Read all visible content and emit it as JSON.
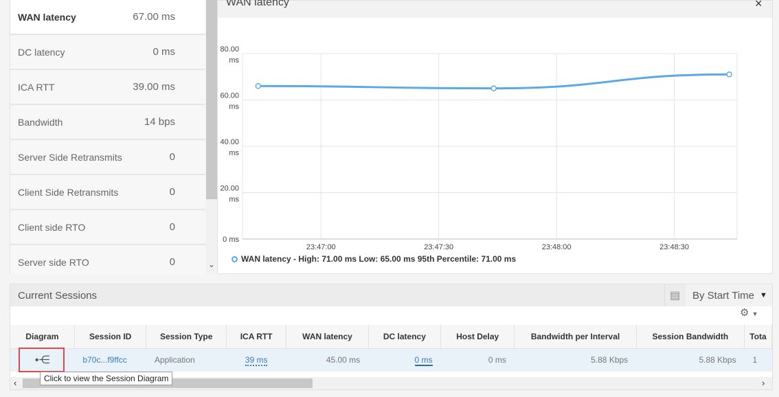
{
  "metrics": [
    {
      "label": "WAN latency",
      "value": "67.00 ms",
      "selected": true
    },
    {
      "label": "DC latency",
      "value": "0 ms"
    },
    {
      "label": "ICA RTT",
      "value": "39.00 ms"
    },
    {
      "label": "Bandwidth",
      "value": "14 bps"
    },
    {
      "label": "Server Side Retransmits",
      "value": "0"
    },
    {
      "label": "Client Side Retransmits",
      "value": "0"
    },
    {
      "label": "Client side RTO",
      "value": "0"
    },
    {
      "label": "Server side RTO",
      "value": "0"
    }
  ],
  "chart_panel": {
    "title": "WAN latency",
    "close": "×"
  },
  "chart_data": {
    "type": "line",
    "title": "WAN latency",
    "x": [
      "23:46:44",
      "23:47:44",
      "23:48:44"
    ],
    "series": [
      {
        "name": "WAN latency",
        "values": [
          66,
          65,
          71
        ],
        "color": "#5aa9e6"
      }
    ],
    "x_ticks": [
      "23:47:00",
      "23:47:30",
      "23:48:00",
      "23:48:30"
    ],
    "y_ticks": [
      "0 ms",
      "20.00 ms",
      "40.00 ms",
      "60.00 ms",
      "80.00 ms"
    ],
    "ylim": [
      0,
      80
    ],
    "xlim": [
      "23:46:40",
      "23:48:46"
    ],
    "grid": true,
    "legend": "WAN latency - High: 71.00 ms Low: 65.00 ms 95th Percentile: 71.00 ms",
    "legend_placement": "bottom-left"
  },
  "sessions": {
    "title": "Current Sessions",
    "sort": "By Start Time",
    "columns": [
      "Diagram",
      "Session ID",
      "Session Type",
      "ICA RTT",
      "WAN latency",
      "DC latency",
      "Host Delay",
      "Bandwidth per Interval",
      "Session Bandwidth",
      "Tota"
    ],
    "rows": [
      {
        "session_id": "b70c...f9ffcc",
        "session_type": "Application",
        "ica_rtt": "39 ms",
        "wan_latency": "45.00 ms",
        "dc_latency": "0 ms",
        "host_delay": "0 ms",
        "bw_interval": "5.88 Kbps",
        "session_bw": "5.88 Kbps",
        "total": "1"
      }
    ],
    "tooltip": "Click to view the Session Diagram"
  }
}
